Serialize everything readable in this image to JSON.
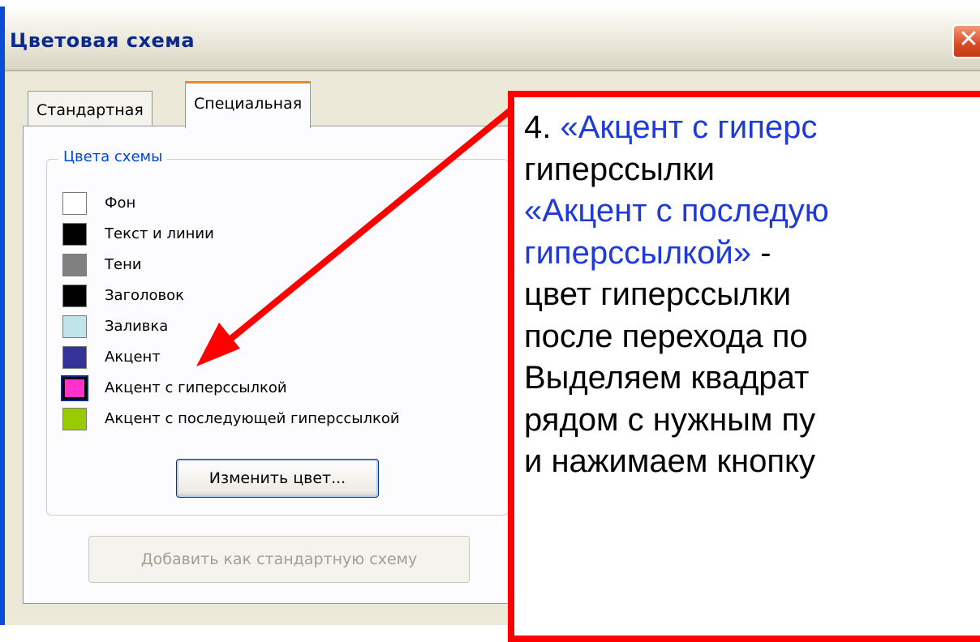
{
  "window": {
    "title": "Цветовая схема",
    "close_label": "✕"
  },
  "tabs": [
    {
      "label": "Стандартная",
      "active": false
    },
    {
      "label": "Специальная",
      "active": true
    }
  ],
  "group": {
    "title": "Цвета схемы",
    "items": [
      {
        "label": "Фон",
        "color": "#ffffff"
      },
      {
        "label": "Текст и линии",
        "color": "#000000"
      },
      {
        "label": "Тени",
        "color": "#808080"
      },
      {
        "label": "Заголовок",
        "color": "#000000"
      },
      {
        "label": "Заливка",
        "color": "#bfe4ea"
      },
      {
        "label": "Акцент",
        "color": "#333399"
      },
      {
        "label": "Акцент с гиперссылкой",
        "color": "#ff33cc",
        "selected": true
      },
      {
        "label": "Акцент с последующей гиперссылкой",
        "color": "#99cc00"
      }
    ]
  },
  "buttons": {
    "change_color": "Изменить цвет...",
    "add_standard": "Добавить как стандартную схему"
  },
  "callout": {
    "lines": [
      {
        "number": "4. ",
        "text": "«Акцент с гиперс"
      },
      {
        "text": "гиперссылки"
      },
      {
        "text": "«Акцент с последую"
      },
      {
        "text": "гиперссылкой» ",
        "suffix": "-"
      },
      {
        "text": "цвет гиперссылки"
      },
      {
        "text": "после перехода по"
      },
      {
        "text": "Выделяем квадрат"
      },
      {
        "text": "рядом с нужным пу"
      },
      {
        "text": "и нажимаем кнопку"
      }
    ]
  },
  "colors": {
    "annotation": "#ff0000",
    "callout_link_text": "#1e3ad8",
    "title_text": "#0b2a8a"
  }
}
